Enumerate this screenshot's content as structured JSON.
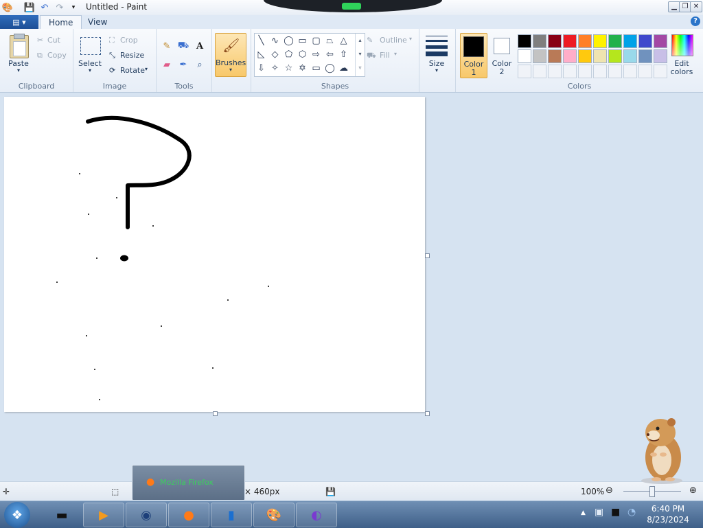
{
  "window": {
    "title": "Untitled - Paint",
    "controls": [
      "minimize-icon",
      "restore-icon",
      "close-icon"
    ]
  },
  "quick_access": [
    "app-icon",
    "save-icon",
    "undo-icon",
    "redo-icon",
    "customize-icon"
  ],
  "tabs": [
    {
      "label": "Home",
      "active": true
    },
    {
      "label": "View",
      "active": false
    }
  ],
  "ribbon": {
    "clipboard": {
      "label": "Clipboard",
      "paste": "Paste",
      "cut": "Cut",
      "copy": "Copy"
    },
    "image": {
      "label": "Image",
      "select": "Select",
      "crop": "Crop",
      "resize": "Resize",
      "rotate": "Rotate"
    },
    "tools": {
      "label": "Tools",
      "items": [
        "pencil-icon",
        "fill-icon",
        "text-icon",
        "eraser-icon",
        "color-picker-icon",
        "magnifier-icon"
      ]
    },
    "brushes": {
      "label": "Brushes"
    },
    "shapes": {
      "label": "Shapes",
      "outline": "Outline",
      "fill": "Fill"
    },
    "size": {
      "label": "Size"
    },
    "colors": {
      "label": "Colors",
      "color1_label": "Color",
      "color1_num": "1",
      "color2_label": "Color",
      "color2_num": "2",
      "edit_label_1": "Edit",
      "edit_label_2": "colors",
      "color1": "#000000",
      "color2": "#ffffff",
      "palette_row1": [
        "#000000",
        "#7f7f7f",
        "#880015",
        "#ed1c24",
        "#ff7f27",
        "#fff200",
        "#22b14c",
        "#00a2e8",
        "#3f48cc",
        "#a349a4"
      ],
      "palette_row2": [
        "#ffffff",
        "#c3c3c3",
        "#b97a57",
        "#ffaec9",
        "#ffc90e",
        "#efe4b0",
        "#b5e61d",
        "#99d9ea",
        "#7092be",
        "#c8bfe7"
      ]
    }
  },
  "status": {
    "size_text": "× 460px",
    "zoom": "100%"
  },
  "taskbar": {
    "popup_label": "Mozilla Firefox",
    "time": "6:40 PM",
    "date": "8/23/2024"
  }
}
